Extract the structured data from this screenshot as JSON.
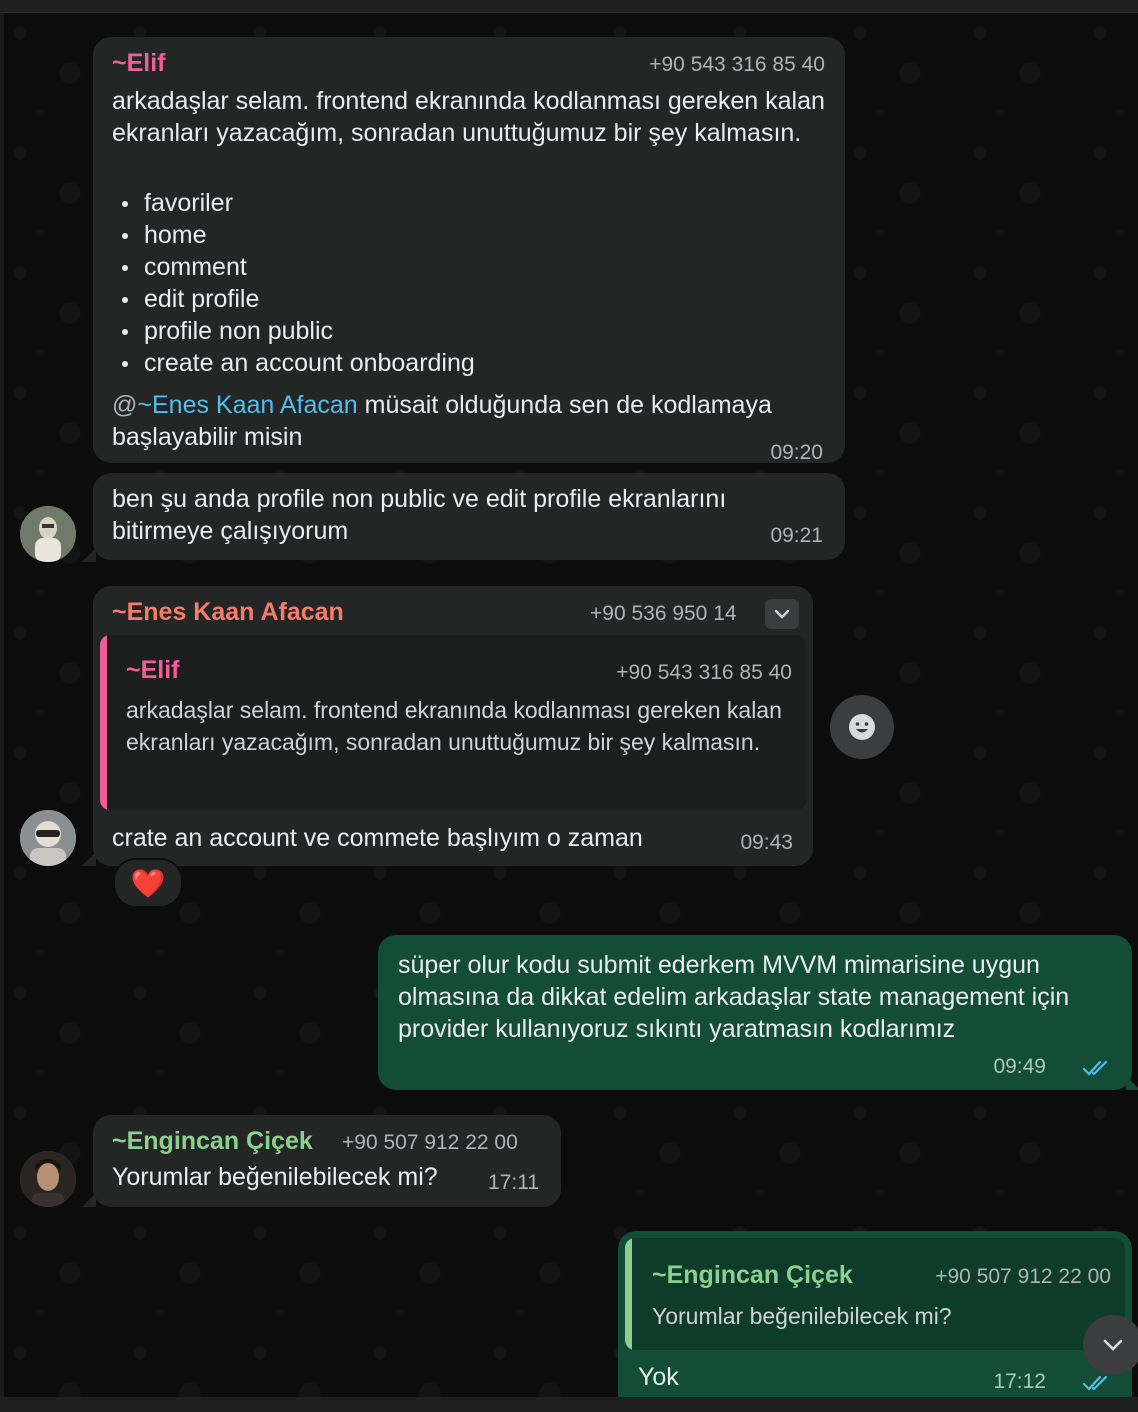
{
  "colors": {
    "elif": "#f15c9a",
    "enes": "#f47c6a",
    "engincan": "#8bd08f",
    "mention": "#53bdeb",
    "incoming_bubble": "#242626",
    "outgoing_bubble": "#134d37"
  },
  "messages": [
    {
      "sender": "~Elif",
      "phone": "+90 543 316 85 40",
      "text": "arkadaşlar selam. frontend ekranında kodlanması gereken kalan ekranları yazacağım, sonradan unuttuğumuz bir şey kalmasın.",
      "list": [
        "favoriler",
        "home",
        "comment",
        "edit profile",
        "profile non public",
        "create an account onboarding"
      ],
      "mention_prefix": "@",
      "mention": "~Enes Kaan Afacan",
      "after_mention": " müsait olduğunda sen de kodlamaya başlayabilir misin",
      "time": "09:20"
    },
    {
      "text": "ben şu anda profile non public ve edit profile ekranlarını bitirmeye çalışıyorum",
      "time": "09:21"
    },
    {
      "sender": "~Enes Kaan Afacan",
      "phone": "+90 536 950 14",
      "quote_sender": "~Elif",
      "quote_phone": "+90 543 316 85 40",
      "quote_text": "arkadaşlar selam. frontend ekranında kodlanması gereken kalan ekranları yazacağım, sonradan unuttuğumuz bir şey kalmasın.",
      "text": "crate an account ve commete başlıyım o zaman",
      "time": "09:43",
      "reaction": "❤️"
    },
    {
      "text": "süper olur kodu submit ederkem MVVM mimarisine uygun olmasına da dikkat edelim arkadaşlar state management için provider kullanıyoruz sıkıntı yaratmasın kodlarımız",
      "time": "09:49",
      "status": "read"
    },
    {
      "sender": "~Engincan Çiçek",
      "phone": "+90 507 912 22 00",
      "text": "Yorumlar beğenilebilecek mi?",
      "time": "17:11"
    },
    {
      "quote_sender": "~Engincan Çiçek",
      "quote_phone": "+90 507 912 22 00",
      "quote_text": "Yorumlar beğenilebilecek mi?",
      "text": "Yok",
      "time": "17:12",
      "status": "read"
    }
  ],
  "icons": {
    "emoji_button": "smiley-icon",
    "scroll_down": "chevron-down-icon",
    "message_menu": "chevron-down-icon",
    "read_receipt": "double-check-icon"
  }
}
